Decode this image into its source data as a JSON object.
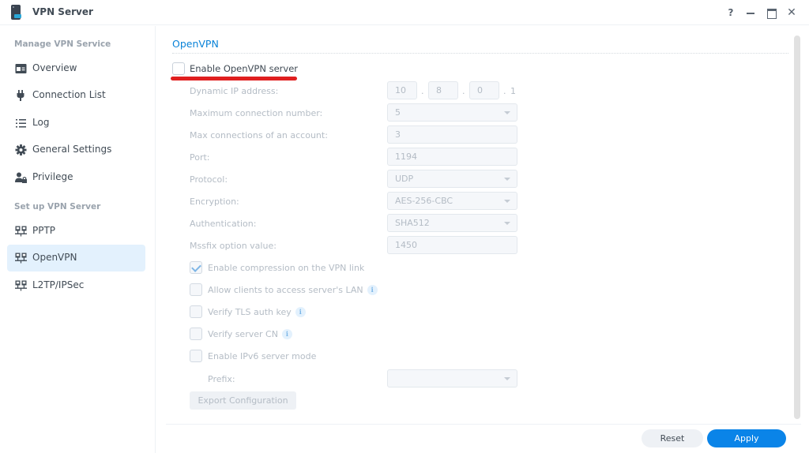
{
  "window": {
    "title": "VPN Server",
    "controls": {
      "help": "?",
      "close": "✕"
    }
  },
  "sidebar": {
    "sections": [
      {
        "heading": "Manage VPN Service",
        "items": [
          {
            "label": "Overview",
            "icon": "overview-icon"
          },
          {
            "label": "Connection List",
            "icon": "plug-icon"
          },
          {
            "label": "Log",
            "icon": "list-icon"
          },
          {
            "label": "General Settings",
            "icon": "gear-icon"
          },
          {
            "label": "Privilege",
            "icon": "user-lock-icon"
          }
        ]
      },
      {
        "heading": "Set up VPN Server",
        "items": [
          {
            "label": "PPTP",
            "icon": "network-icon"
          },
          {
            "label": "OpenVPN",
            "icon": "network-icon",
            "active": true
          },
          {
            "label": "L2TP/IPSec",
            "icon": "network-icon"
          }
        ]
      }
    ]
  },
  "main": {
    "section_title": "OpenVPN",
    "enable_checkbox": {
      "label": "Enable OpenVPN server",
      "checked": false
    },
    "fields": {
      "dynamic_ip": {
        "label": "Dynamic IP address:",
        "octets": [
          "10",
          "8",
          "0"
        ],
        "last_octet": "1",
        "dot": "."
      },
      "max_connections": {
        "label": "Maximum connection number:",
        "value": "5"
      },
      "max_per_account": {
        "label": "Max connections of an account:",
        "value": "3"
      },
      "port": {
        "label": "Port:",
        "value": "1194"
      },
      "protocol": {
        "label": "Protocol:",
        "value": "UDP"
      },
      "encryption": {
        "label": "Encryption:",
        "value": "AES-256-CBC"
      },
      "authentication": {
        "label": "Authentication:",
        "value": "SHA512"
      },
      "mssfix": {
        "label": "Mssfix option value:",
        "value": "1450"
      }
    },
    "options": [
      {
        "label": "Enable compression on the VPN link",
        "checked": true,
        "info": false
      },
      {
        "label": "Allow clients to access server's LAN",
        "checked": false,
        "info": true
      },
      {
        "label": "Verify TLS auth key",
        "checked": false,
        "info": true
      },
      {
        "label": "Verify server CN",
        "checked": false,
        "info": true
      },
      {
        "label": "Enable IPv6 server mode",
        "checked": false,
        "info": false
      }
    ],
    "prefix": {
      "label": "Prefix:",
      "value": ""
    },
    "info_glyph": "i",
    "export_button": "Export Configuration"
  },
  "footer": {
    "reset_label": "Reset",
    "apply_label": "Apply"
  },
  "colors": {
    "accent": "#0a84e8",
    "link_title": "#0a83d8",
    "active_item_bg": "#e3f1fd",
    "annotation_red": "#e01f1f"
  }
}
